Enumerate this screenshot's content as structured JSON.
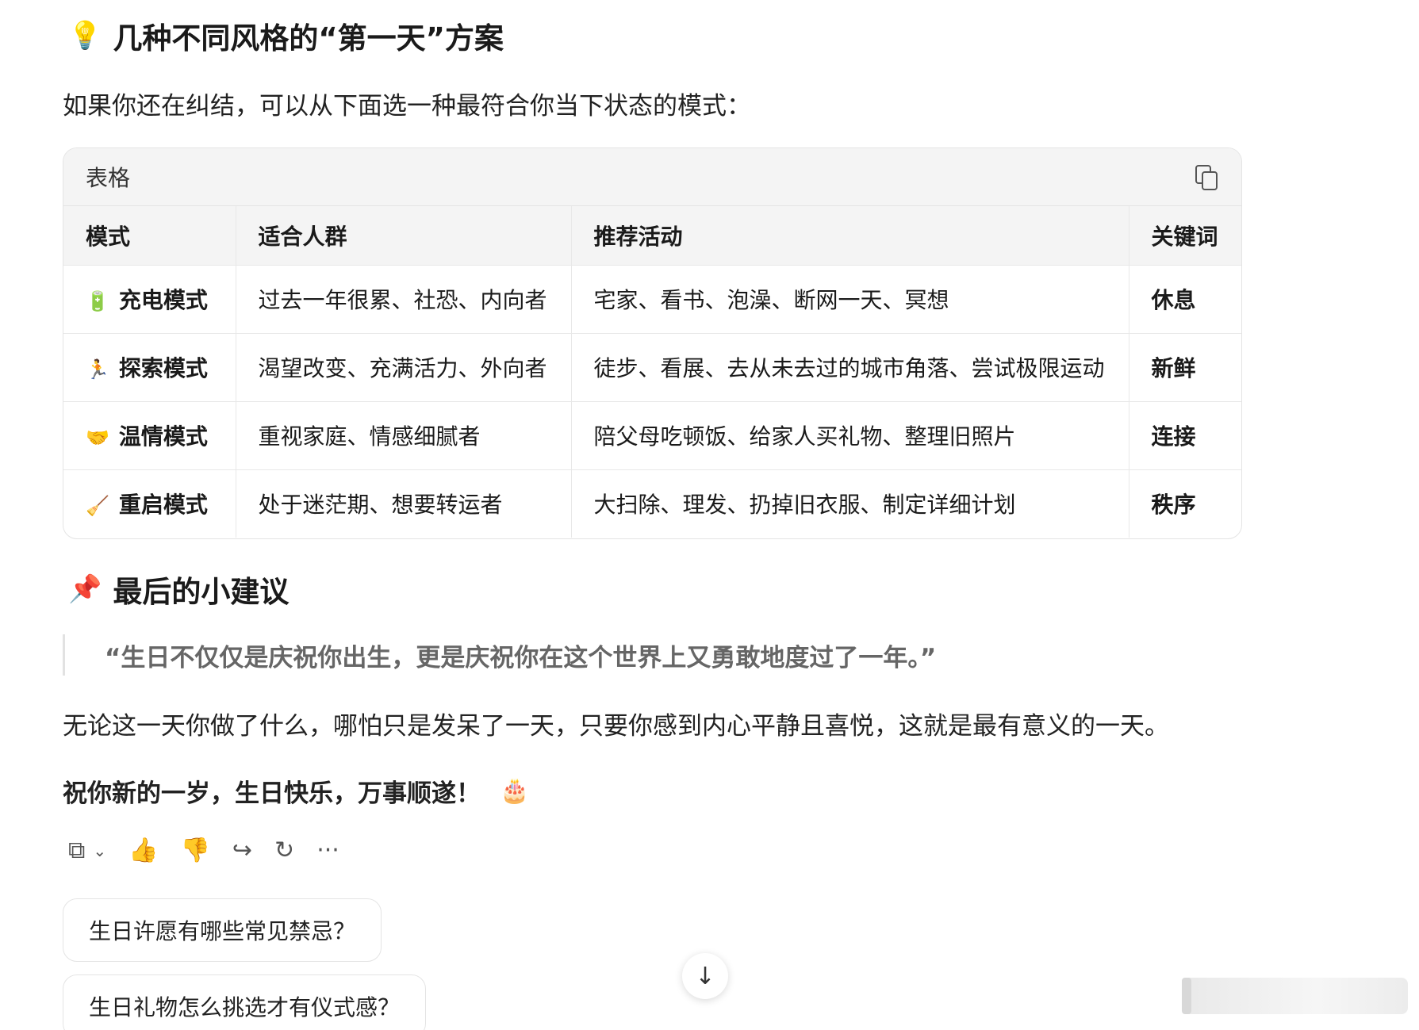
{
  "section1": {
    "emoji": "💡",
    "title": "几种不同风格的“第一天”方案",
    "intro": "如果你还在纠结，可以从下面选一种最符合你当下状态的模式："
  },
  "table": {
    "caption": "表格",
    "headers": [
      "模式",
      "适合人群",
      "推荐活动",
      "关键词"
    ],
    "rows": [
      {
        "emoji": "🔋",
        "mode": "充电模式",
        "people": "过去一年很累、社恐、内向者",
        "activities": "宅家、看书、泡澡、断网一天、冥想",
        "keyword": "休息"
      },
      {
        "emoji": "🏃",
        "mode": "探索模式",
        "people": "渴望改变、充满活力、外向者",
        "activities": "徒步、看展、去从未去过的城市角落、尝试极限运动",
        "keyword": "新鲜"
      },
      {
        "emoji": "🤝",
        "mode": "温情模式",
        "people": "重视家庭、情感细腻者",
        "activities": "陪父母吃顿饭、给家人买礼物、整理旧照片",
        "keyword": "连接"
      },
      {
        "emoji": "🧹",
        "mode": "重启模式",
        "people": "处于迷茫期、想要转运者",
        "activities": "大扫除、理发、扔掉旧衣服、制定详细计划",
        "keyword": "秩序"
      }
    ]
  },
  "section2": {
    "emoji": "📌",
    "title": "最后的小建议",
    "quote": "“生日不仅仅是庆祝你出生，更是庆祝你在这个世界上又勇敢地度过了一年。”",
    "body": "无论这一天你做了什么，哪怕只是发呆了一天，只要你感到内心平静且喜悦，这就是最有意义的一天。",
    "wish": "祝你新的一岁，生日快乐，万事顺遂！",
    "wish_emoji": "🎂"
  },
  "actions": {
    "copy": "⧉",
    "dropdown": "⌄",
    "like": "👍",
    "dislike": "👎",
    "share": "↪",
    "regenerate": "↻",
    "more": "···"
  },
  "suggestions": [
    "生日许愿有哪些常见禁忌？",
    "生日礼物怎么挑选才有仪式感？"
  ],
  "scroll_down": "↓"
}
